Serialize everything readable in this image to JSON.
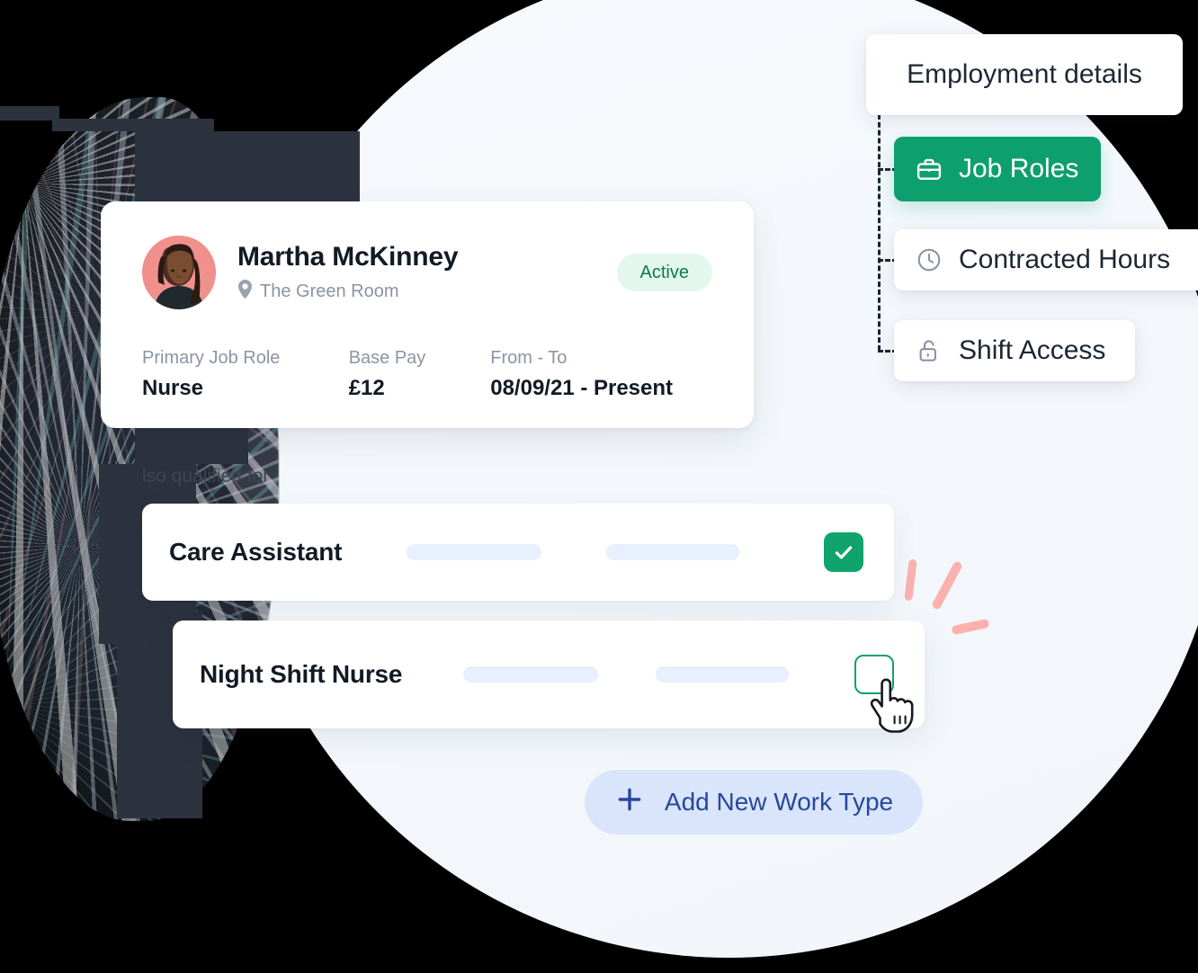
{
  "menu": {
    "header": {
      "label": "Employment details",
      "icon": "none"
    },
    "items": [
      {
        "label": "Job Roles",
        "icon": "briefcase-icon",
        "active": true
      },
      {
        "label": "Contracted Hours",
        "icon": "clock-icon",
        "active": false
      },
      {
        "label": "Shift Access",
        "icon": "unlock-icon",
        "active": false
      }
    ]
  },
  "profile": {
    "name": "Martha McKinney",
    "location": "The Green Room",
    "location_icon": "map-pin-icon",
    "status": "Active",
    "fields": [
      {
        "label": "Primary Job Role",
        "value": "Nurse"
      },
      {
        "label": "Base Pay",
        "value": "£12"
      },
      {
        "label": "From - To",
        "value": "08/09/21 - Present"
      }
    ]
  },
  "qualified": {
    "section_label": "lso qualified for",
    "rows": [
      {
        "name": "Care Assistant",
        "checked": true,
        "checkbox_icon": "checkbox-checked-icon"
      },
      {
        "name": "Night Shift Nurse",
        "checked": false,
        "checkbox_icon": "checkbox-unchecked-icon"
      }
    ]
  },
  "actions": {
    "add_work_type": {
      "label": "Add New Work Type",
      "icon": "plus-icon"
    }
  },
  "colors": {
    "accent_green": "#0e9f6e",
    "checkbox_green": "#10a36d",
    "badge_bg": "#e3f7ec",
    "badge_text": "#0b7a52",
    "button_bg": "#d8e5fb",
    "button_text": "#29479b",
    "skeleton": "#e7f0fc",
    "backdrop": "#f4f8fc",
    "decor_salmon": "#fbb2ae",
    "avatar_bg": "#f0908c"
  }
}
